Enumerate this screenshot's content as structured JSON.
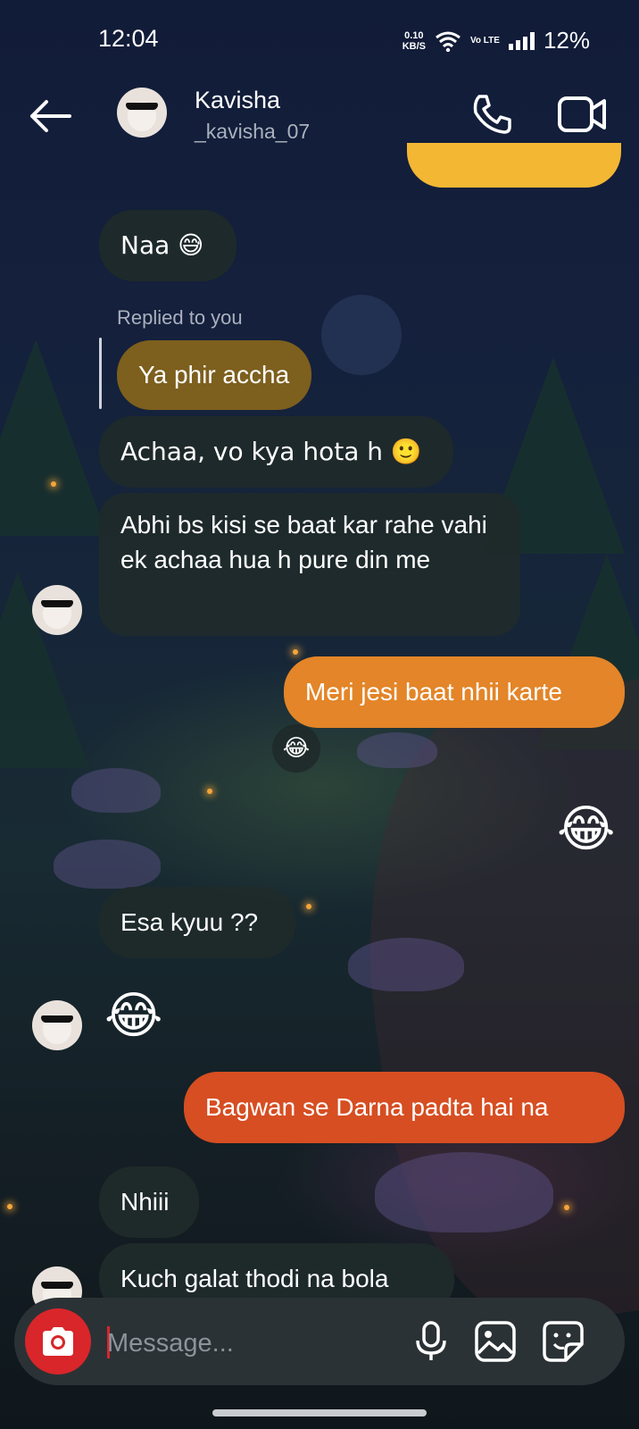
{
  "status_bar": {
    "time": "12:04",
    "speed_value": "0.10",
    "speed_unit": "KB/S",
    "volte": "Vo LTE",
    "battery": "12%"
  },
  "header": {
    "name": "Kavisha",
    "username": "_kavisha_07",
    "icons": [
      "back-arrow-icon",
      "phone-icon",
      "video-call-icon"
    ]
  },
  "messages": {
    "m1": "Naa 😅",
    "replied_label": "Replied to you",
    "replied_quote": "Ya phir accha",
    "m2": "Achaa, vo kya hota h 🙂",
    "m3": "Abhi bs kisi se baat kar rahe vahi ek achaa hua h pure din me",
    "m4": "Meri jesi baat nhii karte",
    "reaction": "😂",
    "m5_emoji": "😂",
    "m6": "Esa kyuu ??",
    "m7_emoji": "😂",
    "m8": "Bagwan se Darna padta hai na",
    "m9": "Nhiii",
    "m10": "Kuch galat thodi na bola"
  },
  "composer": {
    "placeholder": "Message...",
    "icons": [
      "camera-icon",
      "microphone-icon",
      "gallery-icon",
      "sticker-icon"
    ]
  },
  "colors": {
    "outgoing_top": "#f3b734",
    "outgoing_mid": "#e38528",
    "outgoing_bottom": "#d64e22",
    "camera_button": "#d8262a"
  }
}
